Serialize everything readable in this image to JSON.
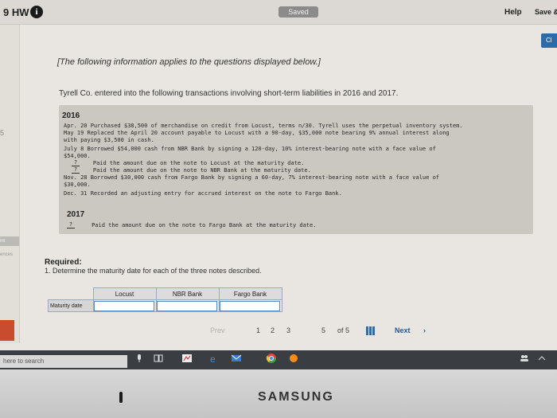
{
  "header": {
    "title": "9 HW",
    "info_icon": "i",
    "saved": "Saved",
    "help": "Help",
    "save_exit": "Save &"
  },
  "corner_button": "Cl",
  "left_strip": {
    "number": "5",
    "tab1": "int",
    "tab2": "ences"
  },
  "problem": {
    "intro": "[The following information applies to the questions displayed below.]",
    "lead": "Tyrell Co. entered into the following transactions involving short-term liabilities in 2016 and 2017.",
    "year1": "2016",
    "lines": [
      "Apr. 20 Purchased $38,500 of merchandise on credit from Locust, terms n/30. Tyrell uses the perpetual inventory system.",
      "May  19 Replaced the April 20 account payable to Locust with a 90-day, $35,000 note bearing 9% annual interest along",
      "        with paying $3,500 in cash.",
      "July  8 Borrowed $54,000 cash from NBR Bank by signing a 120-day, 10% interest-bearing note with a face value of",
      "        $54,000.",
      "Paid the amount due on the note to Locust at the maturity date.",
      "Paid the amount due on the note to NBR Bank at the maturity date.",
      "Nov. 28 Borrowed $30,000 cash from Fargo Bank by signing a 60-day, 7% interest-bearing note with a face value of",
      "        $30,000.",
      "Dec. 31 Recorded an adjusting entry for accrued interest on the note to Fargo Bank."
    ],
    "blank_mark": "?",
    "year2": "2017",
    "line2017": "Paid the amount due on the note to Fargo Bank at the maturity date."
  },
  "required": {
    "title": "Required:",
    "question": "1. Determine the maturity date for each of the three notes described.",
    "columns": [
      "Locust",
      "NBR Bank",
      "Fargo Bank"
    ],
    "row_label": "Maturity date",
    "values": [
      "",
      "",
      ""
    ]
  },
  "pager": {
    "prev": "Prev",
    "pages": [
      "1",
      "2",
      "3",
      "5"
    ],
    "of": "of 5",
    "next": "Next"
  },
  "taskbar": {
    "search": "here to search"
  },
  "bezel": {
    "brand": "SAMSUNG"
  }
}
